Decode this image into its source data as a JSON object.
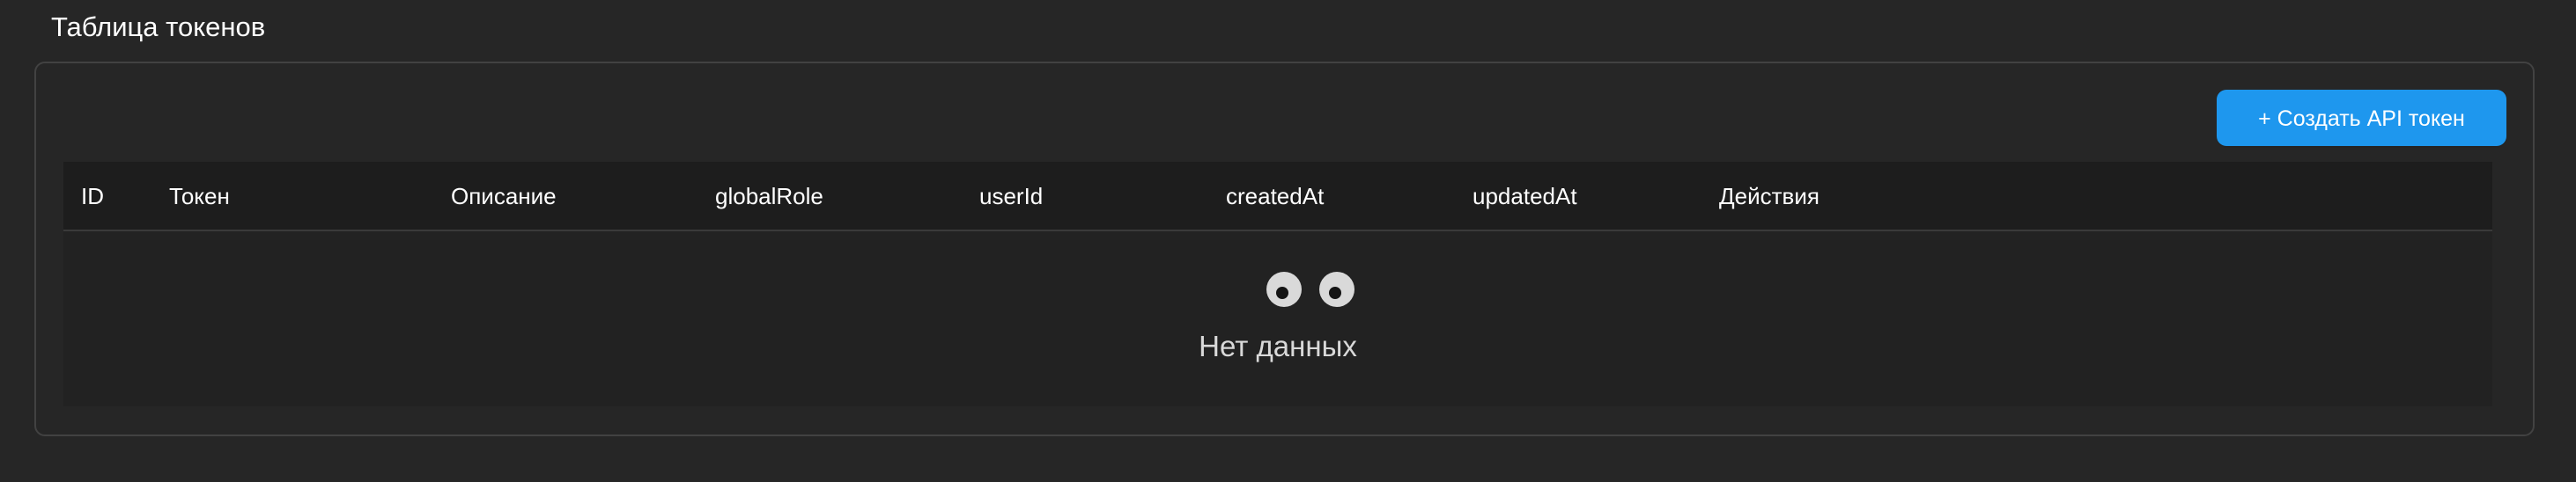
{
  "section": {
    "title": "Таблица токенов"
  },
  "toolbar": {
    "create_button_label": "+ Создать API токен"
  },
  "table": {
    "columns": [
      "ID",
      "Токен",
      "Описание",
      "globalRole",
      "userId",
      "createdAt",
      "updatedAt",
      "Действия"
    ],
    "rows": []
  },
  "empty_state": {
    "icon": "eyes-icon",
    "text": "Нет данных"
  },
  "colors": {
    "background": "#262626",
    "accent": "#1e97ee",
    "header_bg": "#1d1d1d",
    "border": "#424242"
  }
}
